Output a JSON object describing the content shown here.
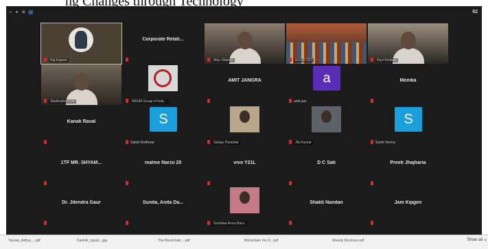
{
  "banner_text": "ng Changes through Technology",
  "window": {
    "participant_count": "82",
    "tiles": [
      {
        "id": "raj",
        "display": "video",
        "label": "Raj Kapoor"
      },
      {
        "id": "corp",
        "display": "name",
        "name": "Corporate  Relati..."
      },
      {
        "id": "anju",
        "display": "video",
        "label": "Anju Sharma"
      },
      {
        "id": "elcm",
        "display": "video",
        "label": "ELCM CET"
      },
      {
        "id": "ravi",
        "display": "video",
        "label": "Ravi Kindwar"
      },
      {
        "id": "shailendra",
        "display": "video",
        "label": "Shailendra Kohli"
      },
      {
        "id": "rkgm",
        "display": "video",
        "label": "RKGM Group of Insti..."
      },
      {
        "id": "amit",
        "display": "name",
        "name": "AMIT JANGRA"
      },
      {
        "id": "amitjain",
        "display": "avatar",
        "letter": "a",
        "label": "amit jain",
        "color": "#5b2db8"
      },
      {
        "id": "monika",
        "display": "name",
        "name": "Monika"
      },
      {
        "id": "kanak",
        "display": "name",
        "name": "Kanak Raval"
      },
      {
        "id": "satish",
        "display": "avatar",
        "letter": "S",
        "label": "Satish Bodhwar",
        "color": "#1a9fdc"
      },
      {
        "id": "sanjay",
        "display": "video",
        "label": "Sanjay Parashar"
      },
      {
        "id": "jitu",
        "display": "video",
        "label": "Jitu Kumar"
      },
      {
        "id": "sumit",
        "display": "avatar",
        "letter": "S",
        "label": "Sumit Verma",
        "color": "#1a9fdc"
      },
      {
        "id": "shyam",
        "display": "name",
        "name": "1TF MR. SHYAM..."
      },
      {
        "id": "narzo",
        "display": "name",
        "name": "realme Narzo 20"
      },
      {
        "id": "vivo",
        "display": "name",
        "name": "vivo Y21L"
      },
      {
        "id": "dcsati",
        "display": "name",
        "name": "D C Sati"
      },
      {
        "id": "preeti",
        "display": "name",
        "name": "Preeti Jhajharia"
      },
      {
        "id": "jitendra",
        "display": "name",
        "name": "Dr. Jitendra Gaur"
      },
      {
        "id": "sunita",
        "display": "name",
        "name": "Sunita,  Anita Da..."
      },
      {
        "id": "suchitaa",
        "display": "video",
        "label": "Suchitaa Arora Bara..."
      },
      {
        "id": "shakti",
        "display": "name",
        "name": "Shakti Nandan"
      },
      {
        "id": "jam",
        "display": "name",
        "name": "Jam Kipgen"
      }
    ]
  },
  "taskbar": {
    "items": [
      "Topraw_Aditya_...pdf",
      "Dainnik_nguse...jpg",
      "The Blockchain ...pdf",
      "Blockchain For D...pdf",
      "Weekly Brochure.pdf"
    ],
    "show_all": "Show all",
    "close": "×"
  }
}
